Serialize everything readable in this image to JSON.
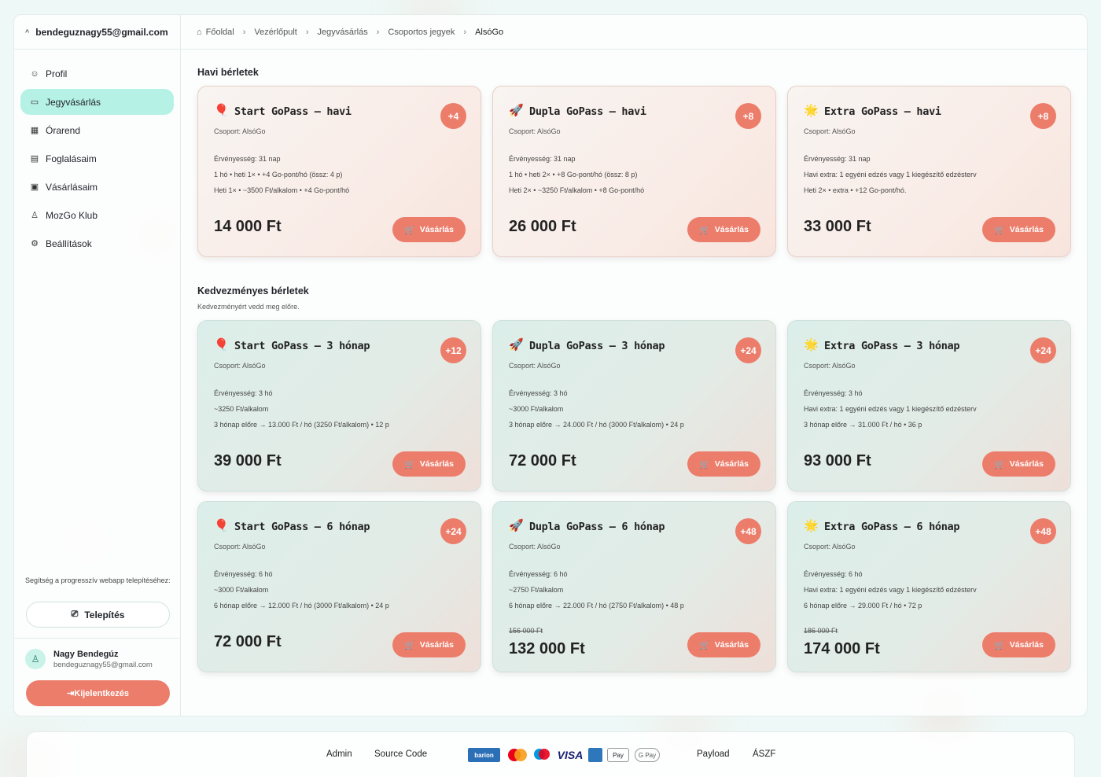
{
  "sidebar": {
    "account_email": "bendeguznagy55@gmail.com",
    "items": [
      {
        "icon": "user-circle-icon",
        "glyph": "☺",
        "label": "Profil",
        "active": false
      },
      {
        "icon": "ticket-icon",
        "glyph": "▭",
        "label": "Jegyvásárlás",
        "active": true
      },
      {
        "icon": "calendar-icon",
        "glyph": "▦",
        "label": "Órarend",
        "active": false
      },
      {
        "icon": "booking-icon",
        "glyph": "▤",
        "label": "Foglalásaim",
        "active": false
      },
      {
        "icon": "purchases-icon",
        "glyph": "▣",
        "label": "Vásárlásaim",
        "active": false
      },
      {
        "icon": "award-icon",
        "glyph": "♙",
        "label": "MozGo Klub",
        "active": false
      },
      {
        "icon": "gear-icon",
        "glyph": "⚙",
        "label": "Beállítások",
        "active": false
      }
    ],
    "help_text": "Segítség a progresszív webapp telepítéséhez:",
    "install_label": "Telepítés",
    "user_name": "Nagy Bendegúz",
    "user_email": "bendeguznagy55@gmail.com",
    "logout_label": "Kijelentkezés"
  },
  "breadcrumb": [
    "Főoldal",
    "Vezérlőpult",
    "Jegyvásárlás",
    "Csoportos jegyek",
    "AlsóGo"
  ],
  "monthly": {
    "title": "Havi bérletek",
    "cards": [
      {
        "emoji": "🎈",
        "title": "Start GoPass – havi",
        "badge": "+4",
        "group": "Csoport: AlsóGo",
        "lines": [
          "Érvényesség: 31 nap",
          "1 hó • heti 1× • +4 Go-pont/hó (össz: 4 p)",
          "Heti 1× • ~3500 Ft/alkalom • +4 Go-pont/hó"
        ],
        "old_price": "",
        "price": "14 000 Ft",
        "buy": "Vásárlás"
      },
      {
        "emoji": "🚀",
        "title": "Dupla GoPass – havi",
        "badge": "+8",
        "group": "Csoport: AlsóGo",
        "lines": [
          "Érvényesség: 31 nap",
          "1 hó • heti 2× • +8 Go-pont/hó (össz: 8 p)",
          "Heti 2× • ~3250 Ft/alkalom • +8 Go-pont/hó"
        ],
        "old_price": "",
        "price": "26 000 Ft",
        "buy": "Vásárlás"
      },
      {
        "emoji": "🌟",
        "title": "Extra GoPass – havi",
        "badge": "+8",
        "group": "Csoport: AlsóGo",
        "lines": [
          "Érvényesség: 31 nap",
          "Havi extra: 1 egyéni edzés vagy 1 kiegészítő edzésterv",
          "Heti 2× • extra • +12 Go-pont/hó."
        ],
        "old_price": "",
        "price": "33 000 Ft",
        "buy": "Vásárlás"
      }
    ]
  },
  "discount": {
    "title": "Kedvezményes bérletek",
    "subtitle": "Kedvezményért vedd meg előre.",
    "cards": [
      {
        "emoji": "🎈",
        "title": "Start GoPass – 3 hónap",
        "badge": "+12",
        "group": "Csoport: AlsóGo",
        "lines": [
          "Érvényesség: 3 hó",
          "~3250 Ft/alkalom",
          "3 hónap előre → 13.000 Ft / hó (3250 Ft/alkalom) • 12 p"
        ],
        "old_price": "",
        "price": "39 000 Ft",
        "buy": "Vásárlás"
      },
      {
        "emoji": "🚀",
        "title": "Dupla GoPass – 3 hónap",
        "badge": "+24",
        "group": "Csoport: AlsóGo",
        "lines": [
          "Érvényesség: 3 hó",
          "~3000 Ft/alkalom",
          "3 hónap előre → 24.000 Ft / hó (3000 Ft/alkalom) • 24 p"
        ],
        "old_price": "",
        "price": "72 000 Ft",
        "buy": "Vásárlás"
      },
      {
        "emoji": "🌟",
        "title": "Extra GoPass – 3 hónap",
        "badge": "+24",
        "group": "Csoport: AlsóGo",
        "lines": [
          "Érvényesség: 3 hó",
          "Havi extra: 1 egyéni edzés vagy 1 kiegészítő edzésterv",
          "3 hónap előre → 31.000 Ft / hó • 36 p"
        ],
        "old_price": "",
        "price": "93 000 Ft",
        "buy": "Vásárlás"
      },
      {
        "emoji": "🎈",
        "title": "Start GoPass – 6 hónap",
        "badge": "+24",
        "group": "Csoport: AlsóGo",
        "lines": [
          "Érvényesség: 6 hó",
          "~3000 Ft/alkalom",
          "6 hónap előre → 12.000 Ft / hó (3000 Ft/alkalom) • 24 p"
        ],
        "old_price": "",
        "price": "72 000 Ft",
        "buy": "Vásárlás"
      },
      {
        "emoji": "🚀",
        "title": "Dupla GoPass – 6 hónap",
        "badge": "+48",
        "group": "Csoport: AlsóGo",
        "lines": [
          "Érvényesség: 6 hó",
          "~2750 Ft/alkalom",
          "6 hónap előre → 22.000 Ft / hó (2750 Ft/alkalom) • 48 p"
        ],
        "old_price": "156 000 Ft",
        "price": "132 000 Ft",
        "buy": "Vásárlás"
      },
      {
        "emoji": "🌟",
        "title": "Extra GoPass – 6 hónap",
        "badge": "+48",
        "group": "Csoport: AlsóGo",
        "lines": [
          "Érvényesség: 6 hó",
          "Havi extra: 1 egyéni edzés vagy 1 kiegészítő edzésterv",
          "6 hónap előre → 29.000 Ft / hó • 72 p"
        ],
        "old_price": "186 000 Ft",
        "price": "174 000 Ft",
        "buy": "Vásárlás"
      }
    ]
  },
  "footer": {
    "admin": "Admin",
    "source": "Source Code",
    "payload": "Payload",
    "aszf": "ÁSZF",
    "payments": [
      "barion",
      "VISA",
      "Pay",
      "G Pay"
    ]
  },
  "colors": {
    "accent": "#ec7d6b",
    "active_nav": "#b6f1e6",
    "background": "#eef8f6"
  }
}
